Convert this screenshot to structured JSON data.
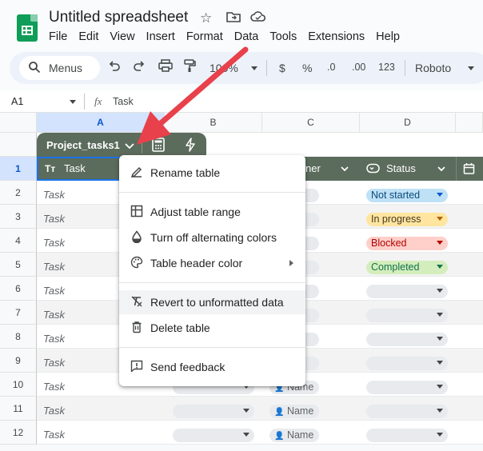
{
  "doc_title": "Untitled spreadsheet",
  "menubar": [
    "File",
    "Edit",
    "View",
    "Insert",
    "Format",
    "Data",
    "Tools",
    "Extensions",
    "Help"
  ],
  "toolbar": {
    "menus_label": "Menus",
    "zoom": "100%",
    "currency": "$",
    "percent": "%",
    "decimal_decrease": ".0",
    "decimal_increase": ".00",
    "number_format": "123",
    "font": "Roboto"
  },
  "formula_bar": {
    "cell_ref": "A1",
    "fx": "fx",
    "value": "Task"
  },
  "columns": [
    "A",
    "B",
    "C",
    "D"
  ],
  "table": {
    "name": "Project_tasks1",
    "headers": {
      "task": "Task",
      "owner": "ner",
      "status": "Status"
    }
  },
  "rows": [
    {
      "num": "1"
    },
    {
      "num": "2",
      "task": "Task",
      "status": "Not started",
      "status_color": "#bfe1f6"
    },
    {
      "num": "3",
      "task": "Task",
      "status": "In progress",
      "status_color": "#ffe5a0"
    },
    {
      "num": "4",
      "task": "Task",
      "status": "Blocked",
      "status_color": "#ffcfc9"
    },
    {
      "num": "5",
      "task": "Task",
      "status": "Completed",
      "status_color": "#d4edbc"
    },
    {
      "num": "6",
      "task": "Task"
    },
    {
      "num": "7",
      "task": "Task"
    },
    {
      "num": "8",
      "task": "Task"
    },
    {
      "num": "9",
      "task": "Task"
    },
    {
      "num": "10",
      "task": "Task",
      "owner": "Name"
    },
    {
      "num": "11",
      "task": "Task",
      "owner": "Name"
    },
    {
      "num": "12",
      "task": "Task",
      "owner": "Name"
    }
  ],
  "context_menu": [
    {
      "label": "Rename table",
      "icon": "rename-icon"
    },
    {
      "label": "Adjust table range",
      "icon": "table-range-icon"
    },
    {
      "label": "Turn off alternating colors",
      "icon": "fill-drop-icon"
    },
    {
      "label": "Table header color",
      "icon": "palette-icon"
    },
    {
      "label": "Revert to unformatted data",
      "icon": "clear-format-icon"
    },
    {
      "label": "Delete table",
      "icon": "trash-icon"
    },
    {
      "label": "Send feedback",
      "icon": "feedback-icon"
    }
  ],
  "colors": {
    "table_header": "#5b6b5c",
    "selection": "#1a73e8",
    "arrow": "#e8414b"
  }
}
